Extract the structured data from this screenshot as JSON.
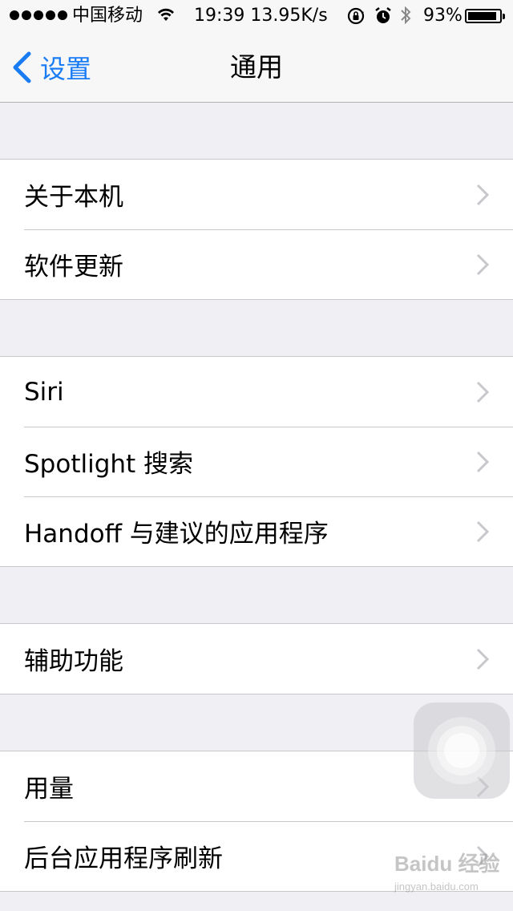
{
  "status_bar": {
    "carrier": "中国移动",
    "time": "19:39 13.95K/s",
    "battery_percent": "93%",
    "battery_level": 0.93,
    "signal_dots": 5,
    "icons": [
      "signal-dots-icon",
      "wifi-icon",
      "rotation-lock-icon",
      "alarm-icon",
      "bluetooth-icon",
      "battery-icon"
    ]
  },
  "nav": {
    "back_label": "设置",
    "title": "通用",
    "accent_color": "#1a7cf5"
  },
  "groups": [
    {
      "items": [
        {
          "label": "关于本机"
        },
        {
          "label": "软件更新"
        }
      ]
    },
    {
      "items": [
        {
          "label": "Siri"
        },
        {
          "label": "Spotlight 搜索"
        },
        {
          "label": "Handoff 与建议的应用程序"
        }
      ]
    },
    {
      "items": [
        {
          "label": "辅助功能"
        }
      ]
    },
    {
      "items": [
        {
          "label": "用量"
        },
        {
          "label": "后台应用程序刷新"
        }
      ]
    }
  ],
  "watermark": {
    "text": "Baidu 经验",
    "sub": "jingyan.baidu.com"
  }
}
